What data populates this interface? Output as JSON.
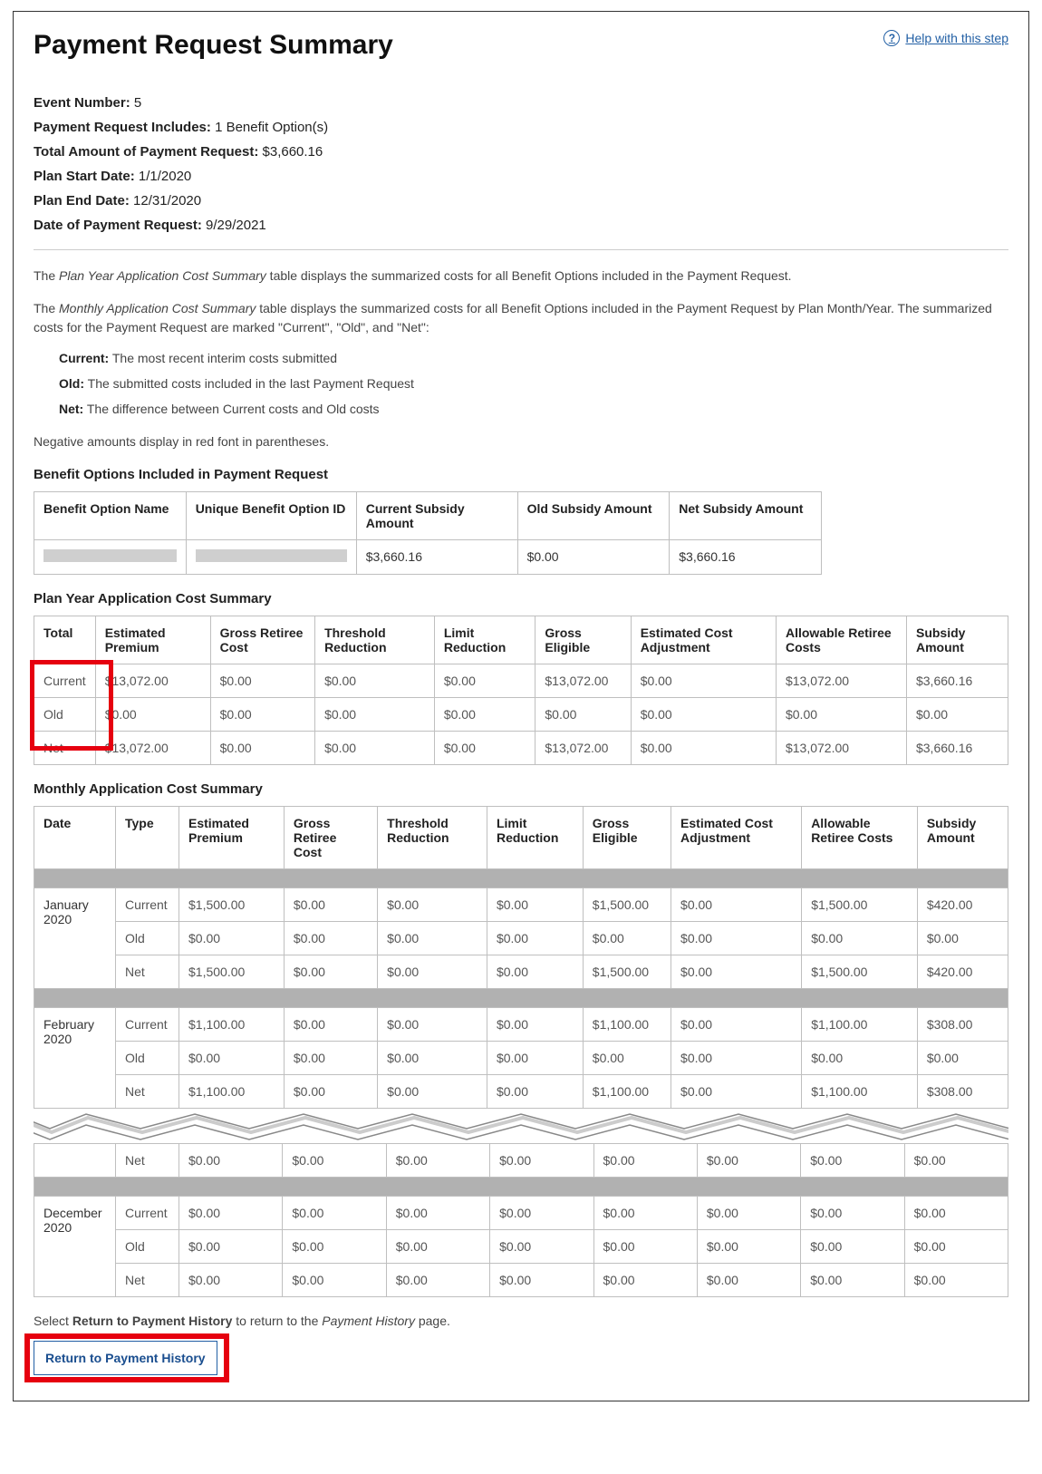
{
  "header": {
    "title": "Payment Request Summary",
    "help_label": "Help with this step"
  },
  "summary": {
    "event_number_label": "Event Number:",
    "event_number_value": "5",
    "includes_label": "Payment Request Includes:",
    "includes_value": "1 Benefit Option(s)",
    "total_label": "Total Amount of Payment Request:",
    "total_value": "$3,660.16",
    "plan_start_label": "Plan Start Date:",
    "plan_start_value": "1/1/2020",
    "plan_end_label": "Plan End Date:",
    "plan_end_value": "12/31/2020",
    "date_req_label": "Date of Payment Request:",
    "date_req_value": "9/29/2021"
  },
  "descriptions": {
    "para1_pre": "The ",
    "para1_italic": "Plan Year Application Cost Summary",
    "para1_post": " table displays the summarized costs for all Benefit Options included in the Payment Request.",
    "para2_pre": "The ",
    "para2_italic": "Monthly Application Cost Summary",
    "para2_post": " table displays the summarized costs for all Benefit Options included in the Payment Request by Plan Month/Year. The summarized costs for the Payment Request are marked \"Current\", \"Old\", and \"Net\":",
    "defs": [
      {
        "label": "Current:",
        "text": " The most recent interim costs submitted"
      },
      {
        "label": "Old:",
        "text": " The submitted costs included in the last Payment Request"
      },
      {
        "label": "Net:",
        "text": " The difference between Current costs and Old costs"
      }
    ],
    "neg_note": "Negative amounts display in red font in parentheses."
  },
  "benefit_table": {
    "heading": "Benefit Options Included in Payment Request",
    "headers": [
      "Benefit Option Name",
      "Unique Benefit Option ID",
      "Current Subsidy Amount",
      "Old Subsidy Amount",
      "Net Subsidy Amount"
    ],
    "rows": [
      {
        "current": "$3,660.16",
        "old": "$0.00",
        "net": "$3,660.16"
      }
    ]
  },
  "plan_year": {
    "heading": "Plan Year Application Cost Summary",
    "headers": [
      "Total",
      "Estimated Premium",
      "Gross Retiree Cost",
      "Threshold Reduction",
      "Limit Reduction",
      "Gross Eligible",
      "Estimated Cost Adjustment",
      "Allowable Retiree Costs",
      "Subsidy Amount"
    ],
    "rows": [
      {
        "label": "Current",
        "vals": [
          "$13,072.00",
          "$0.00",
          "$0.00",
          "$0.00",
          "$13,072.00",
          "$0.00",
          "$13,072.00",
          "$3,660.16"
        ]
      },
      {
        "label": "Old",
        "vals": [
          "$0.00",
          "$0.00",
          "$0.00",
          "$0.00",
          "$0.00",
          "$0.00",
          "$0.00",
          "$0.00"
        ]
      },
      {
        "label": "Net",
        "vals": [
          "$13,072.00",
          "$0.00",
          "$0.00",
          "$0.00",
          "$13,072.00",
          "$0.00",
          "$13,072.00",
          "$3,660.16"
        ]
      }
    ]
  },
  "monthly": {
    "heading": "Monthly Application Cost Summary",
    "headers": [
      "Date",
      "Type",
      "Estimated Premium",
      "Gross Retiree Cost",
      "Threshold Reduction",
      "Limit Reduction",
      "Gross Eligible",
      "Estimated Cost Adjustment",
      "Allowable Retiree Costs",
      "Subsidy Amount"
    ],
    "groups": [
      {
        "date": "January 2020",
        "rows": [
          {
            "type": "Current",
            "vals": [
              "$1,500.00",
              "$0.00",
              "$0.00",
              "$0.00",
              "$1,500.00",
              "$0.00",
              "$1,500.00",
              "$420.00"
            ]
          },
          {
            "type": "Old",
            "vals": [
              "$0.00",
              "$0.00",
              "$0.00",
              "$0.00",
              "$0.00",
              "$0.00",
              "$0.00",
              "$0.00"
            ]
          },
          {
            "type": "Net",
            "vals": [
              "$1,500.00",
              "$0.00",
              "$0.00",
              "$0.00",
              "$1,500.00",
              "$0.00",
              "$1,500.00",
              "$420.00"
            ]
          }
        ]
      },
      {
        "date": "February 2020",
        "rows": [
          {
            "type": "Current",
            "vals": [
              "$1,100.00",
              "$0.00",
              "$0.00",
              "$0.00",
              "$1,100.00",
              "$0.00",
              "$1,100.00",
              "$308.00"
            ]
          },
          {
            "type": "Old",
            "vals": [
              "$0.00",
              "$0.00",
              "$0.00",
              "$0.00",
              "$0.00",
              "$0.00",
              "$0.00",
              "$0.00"
            ]
          },
          {
            "type": "Net",
            "vals": [
              "$1,100.00",
              "$0.00",
              "$0.00",
              "$0.00",
              "$1,100.00",
              "$0.00",
              "$1,100.00",
              "$308.00"
            ]
          }
        ]
      }
    ],
    "torn_tail_row": {
      "type": "Net",
      "vals": [
        "$0.00",
        "$0.00",
        "$0.00",
        "$0.00",
        "$0.00",
        "$0.00",
        "$0.00",
        "$0.00"
      ]
    },
    "last_group": {
      "date": "December 2020",
      "rows": [
        {
          "type": "Current",
          "vals": [
            "$0.00",
            "$0.00",
            "$0.00",
            "$0.00",
            "$0.00",
            "$0.00",
            "$0.00",
            "$0.00"
          ]
        },
        {
          "type": "Old",
          "vals": [
            "$0.00",
            "$0.00",
            "$0.00",
            "$0.00",
            "$0.00",
            "$0.00",
            "$0.00",
            "$0.00"
          ]
        },
        {
          "type": "Net",
          "vals": [
            "$0.00",
            "$0.00",
            "$0.00",
            "$0.00",
            "$0.00",
            "$0.00",
            "$0.00",
            "$0.00"
          ]
        }
      ]
    }
  },
  "footer": {
    "note_pre": "Select ",
    "note_bold": "Return to Payment History",
    "note_mid": " to return to the ",
    "note_italic": "Payment History",
    "note_post": " page.",
    "btn_label": "Return to Payment History"
  }
}
